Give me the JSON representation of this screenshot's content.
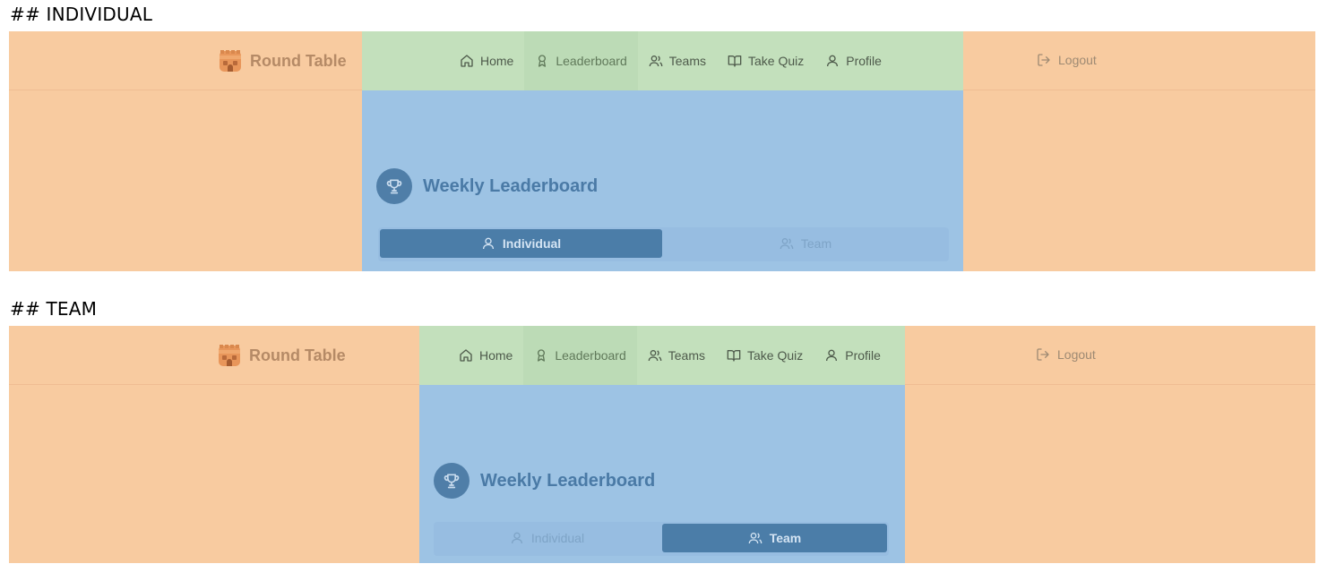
{
  "sections": [
    {
      "heading": "## INDIVIDUAL",
      "brand": {
        "name": "Round Table",
        "logo_icon": "castle-tower-icon"
      },
      "nav": {
        "items": [
          {
            "label": "Home",
            "icon": "home-icon"
          },
          {
            "label": "Leaderboard",
            "icon": "award-icon",
            "active": true
          },
          {
            "label": "Teams",
            "icon": "users-icon"
          },
          {
            "label": "Take Quiz",
            "icon": "book-open-icon"
          },
          {
            "label": "Profile",
            "icon": "user-icon"
          }
        ],
        "logout": "Logout"
      },
      "leaderboard": {
        "title": "Weekly Leaderboard",
        "tabs": [
          {
            "label": "Individual",
            "icon": "user-icon"
          },
          {
            "label": "Team",
            "icon": "users-icon"
          }
        ],
        "active_tab": "Individual"
      }
    },
    {
      "heading": "## TEAM",
      "brand": {
        "name": "Round Table",
        "logo_icon": "castle-tower-icon"
      },
      "nav": {
        "items": [
          {
            "label": "Home",
            "icon": "home-icon"
          },
          {
            "label": "Leaderboard",
            "icon": "award-icon",
            "active": true
          },
          {
            "label": "Teams",
            "icon": "users-icon"
          },
          {
            "label": "Take Quiz",
            "icon": "book-open-icon"
          },
          {
            "label": "Profile",
            "icon": "user-icon"
          }
        ],
        "logout": "Logout"
      },
      "leaderboard": {
        "title": "Weekly Leaderboard",
        "tabs": [
          {
            "label": "Individual",
            "icon": "user-icon"
          },
          {
            "label": "Team",
            "icon": "users-icon"
          }
        ],
        "active_tab": "Team"
      }
    }
  ],
  "colors": {
    "margin_region": "#f8cba0",
    "nav_region": "#c3e0bc",
    "content_region": "#9dc3e4",
    "active_tab": "#4b7da8"
  }
}
